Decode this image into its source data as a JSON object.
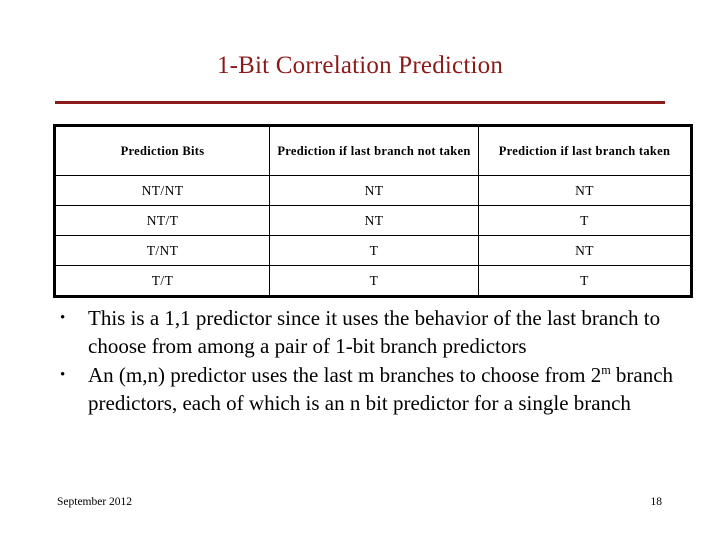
{
  "slide": {
    "title": "1-Bit Correlation Prediction",
    "accent_color": "#8B1A1A",
    "background_color": "#FFFFFF",
    "text_color": "#000000"
  },
  "table": {
    "headers": [
      "Prediction Bits",
      "Prediction if last branch not taken",
      "Prediction if last branch taken"
    ],
    "rows": [
      [
        "NT/NT",
        "NT",
        "NT"
      ],
      [
        "NT/T",
        "NT",
        "T"
      ],
      [
        "T/NT",
        "T",
        "NT"
      ],
      [
        "T/T",
        "T",
        "T"
      ]
    ]
  },
  "bullets": [
    {
      "marker": "•",
      "text": "This is a 1,1 predictor since it uses the behavior of the last branch to choose from among a pair of 1-bit branch predictors"
    },
    {
      "marker": "•",
      "text_before_sup": "An (m,n) predictor uses the last m branches to choose from 2",
      "sup": "m",
      "text_after_sup": " branch predictors, each of which is an n bit predictor for a single branch"
    }
  ],
  "footer": {
    "date": "September 2012",
    "page_number": "18"
  }
}
